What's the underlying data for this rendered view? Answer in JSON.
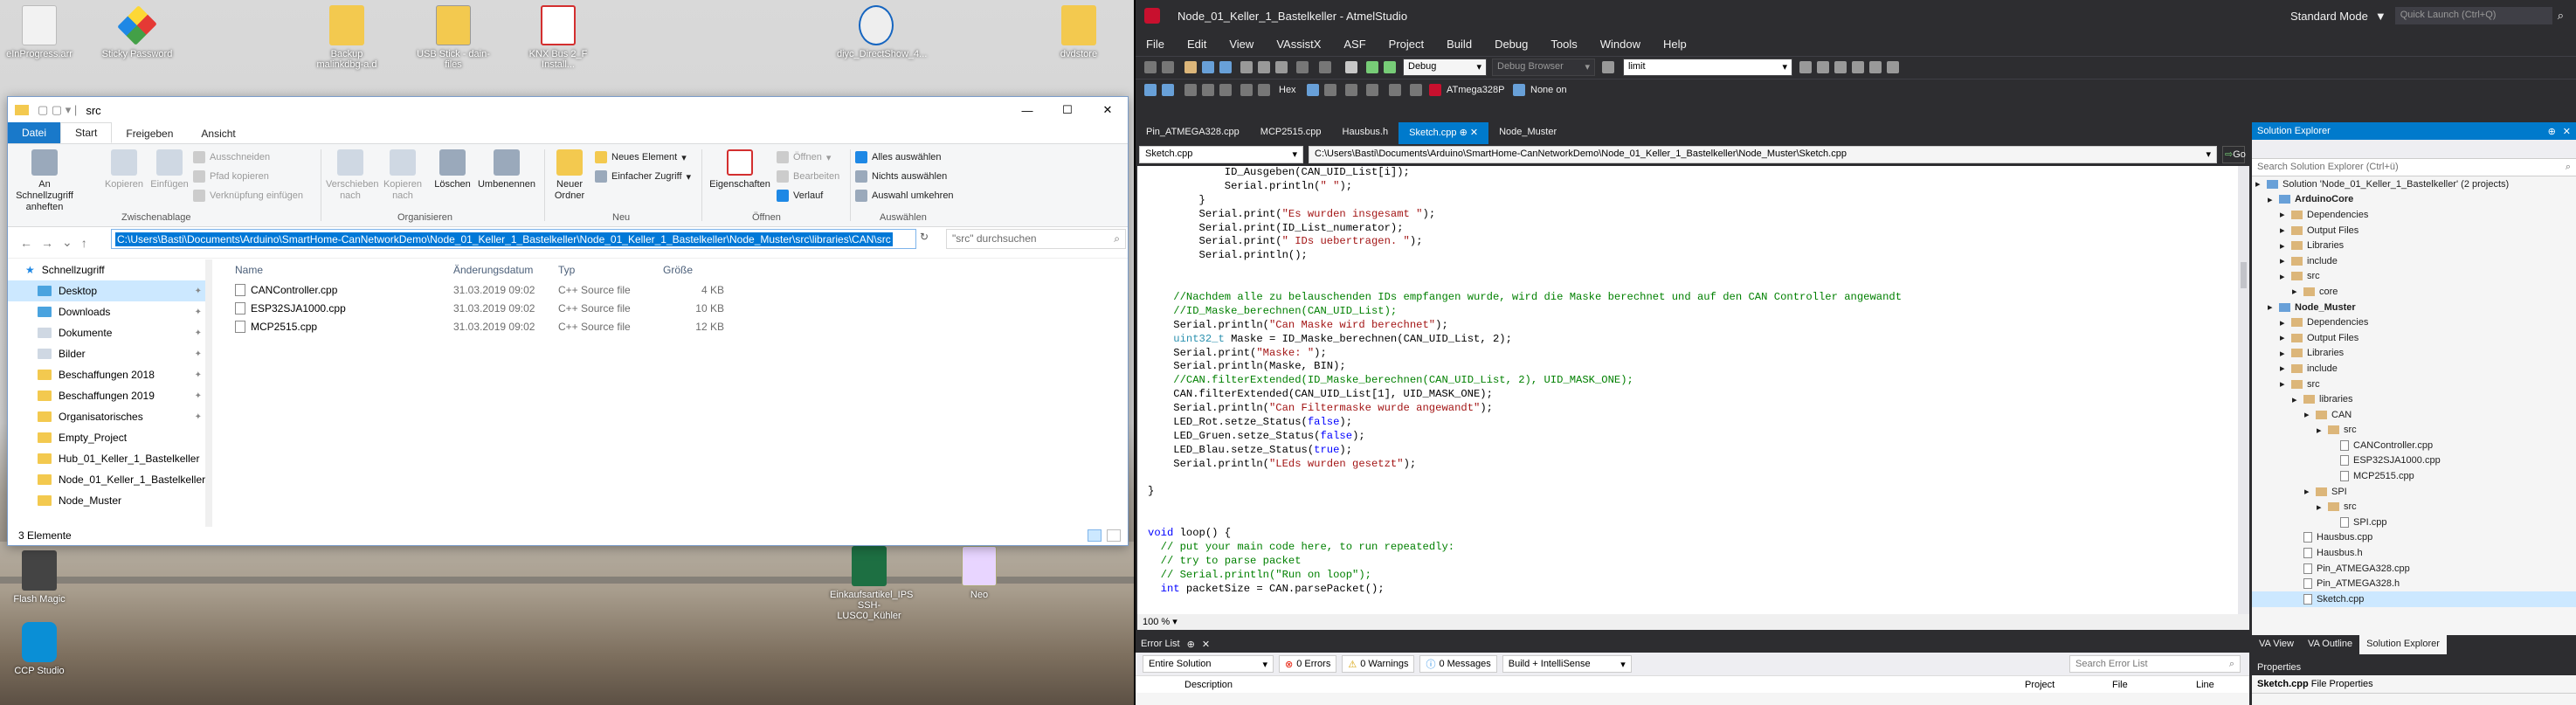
{
  "desktop": {
    "icons": [
      {
        "label": "eInProgress.arr"
      },
      {
        "label": "Sticky Password"
      },
      {
        "label": "Backup malinkdbg-a.d"
      },
      {
        "label": "USB Stick - dain-files"
      },
      {
        "label": "KNX Bus 2_F Install..."
      },
      {
        "label": "diyc_DirectShow_4..."
      },
      {
        "label": "dvdstore"
      },
      {
        "label": "Flash Magic"
      },
      {
        "label": "Einkaufsartikel_IPS SSH-LUSC0_Kühler"
      },
      {
        "label": "Neo"
      },
      {
        "label": "CCP Studio"
      }
    ]
  },
  "explorer": {
    "title": "src",
    "tabs": [
      "Datei",
      "Start",
      "Freigeben",
      "Ansicht"
    ],
    "ribbon": {
      "pin": "An Schnellzugriff anheften",
      "copy": "Kopieren",
      "paste": "Einfügen",
      "cut": "Ausschneiden",
      "copypath": "Pfad kopieren",
      "pasteshortcut": "Verknüpfung einfügen",
      "group_clipboard": "Zwischenablage",
      "move": "Verschieben nach",
      "copyto": "Kopieren nach",
      "delete": "Löschen",
      "rename": "Umbenennen",
      "group_organize": "Organisieren",
      "newfolder": "Neuer Ordner",
      "newitem": "Neues Element",
      "easyaccess": "Einfacher Zugriff",
      "group_new": "Neu",
      "properties": "Eigenschaften",
      "open": "Öffnen",
      "edit": "Bearbeiten",
      "history": "Verlauf",
      "group_open": "Öffnen",
      "selectall": "Alles auswählen",
      "selectnone": "Nichts auswählen",
      "invert": "Auswahl umkehren",
      "group_select": "Auswählen"
    },
    "address": "C:\\Users\\Basti\\Documents\\Arduino\\SmartHome-CanNetworkDemo\\Node_01_Keller_1_Bastelkeller\\Node_01_Keller_1_Bastelkeller\\Node_Muster\\src\\libraries\\CAN\\src",
    "search_placeholder": "\"src\" durchsuchen",
    "nav": [
      "Schnellzugriff",
      "Desktop",
      "Downloads",
      "Dokumente",
      "Bilder",
      "Beschaffungen 2018",
      "Beschaffungen 2019",
      "Organisatorisches",
      "Empty_Project",
      "Hub_01_Keller_1_Bastelkeller",
      "Node_01_Keller_1_Bastelkeller",
      "Node_Muster"
    ],
    "columns": [
      "Name",
      "Änderungsdatum",
      "Typ",
      "Größe"
    ],
    "files": [
      {
        "name": "CANController.cpp",
        "date": "31.03.2019 09:02",
        "type": "C++ Source file",
        "size": "4 KB"
      },
      {
        "name": "ESP32SJA1000.cpp",
        "date": "31.03.2019 09:02",
        "type": "C++ Source file",
        "size": "10 KB"
      },
      {
        "name": "MCP2515.cpp",
        "date": "31.03.2019 09:02",
        "type": "C++ Source file",
        "size": "12 KB"
      }
    ],
    "status": "3 Elemente"
  },
  "atmel": {
    "title": "Node_01_Keller_1_Bastelkeller - AtmelStudio",
    "mode": "Standard Mode",
    "quicklaunch": "Quick Launch (Ctrl+Q)",
    "menu": [
      "File",
      "Edit",
      "View",
      "VAssistX",
      "ASF",
      "Project",
      "Build",
      "Debug",
      "Tools",
      "Window",
      "Help"
    ],
    "config": "Debug",
    "debugbrowser": "Debug Browser",
    "find": "limit",
    "device": "ATmega328P",
    "tool": "None on",
    "hex": "Hex",
    "doctabs": [
      "Pin_ATMEGA328.cpp",
      "MCP2515.cpp",
      "Hausbus.h",
      "Sketch.cpp",
      "Node_Muster"
    ],
    "navfile": "Sketch.cpp",
    "navpath": "C:\\Users\\Basti\\Documents\\Arduino\\SmartHome-CanNetworkDemo\\Node_01_Keller_1_Bastelkeller\\Node_Muster\\Sketch.cpp",
    "go": "Go",
    "code": [
      "            ID_Ausgeben(CAN_UID_List[i]);",
      "            Serial.println(\" \");",
      "        }",
      "        Serial.print(\"Es wurden insgesamt \");",
      "        Serial.print(ID_List_numerator);",
      "        Serial.print(\" IDs uebertragen. \");",
      "        Serial.println();",
      "",
      "",
      "    //Nachdem alle zu belauschenden IDs empfangen wurde, wird die Maske berechnet und auf den CAN Controller angewandt",
      "    //ID_Maske_berechnen(CAN_UID_List);",
      "    Serial.println(\"Can Maske wird berechnet\");",
      "    uint32_t Maske = ID_Maske_berechnen(CAN_UID_List, 2);",
      "    Serial.print(\"Maske: \");",
      "    Serial.println(Maske, BIN);",
      "    //CAN.filterExtended(ID_Maske_berechnen(CAN_UID_List, 2), UID_MASK_ONE);",
      "    CAN.filterExtended(CAN_UID_List[1], UID_MASK_ONE);",
      "    Serial.println(\"Can Filtermaske wurde angewandt\");",
      "    LED_Rot.setze_Status(false);",
      "    LED_Gruen.setze_Status(false);",
      "    LED_Blau.setze_Status(true);",
      "    Serial.println(\"LEds wurden gesetzt\");",
      "",
      "}",
      "",
      "",
      "void loop() {",
      "  // put your main code here, to run repeatedly:",
      "  // try to parse packet",
      "  // Serial.println(\"Run on loop\");",
      "  int packetSize = CAN.parsePacket();"
    ],
    "zoom": "100 %",
    "errorlist": {
      "title": "Error List",
      "scope": "Entire Solution",
      "errors": "0 Errors",
      "warnings": "0 Warnings",
      "messages": "0 Messages",
      "build": "Build + IntelliSense",
      "search": "Search Error List",
      "columns": [
        "Description",
        "Project",
        "File",
        "Line"
      ]
    },
    "solution": {
      "title": "Solution Explorer",
      "search": "Search Solution Explorer (Ctrl+ü)",
      "tree": [
        {
          "label": "Solution 'Node_01_Keller_1_Bastelkeller' (2 projects)",
          "depth": 0,
          "kind": "sol"
        },
        {
          "label": "ArduinoCore",
          "depth": 1,
          "kind": "proj"
        },
        {
          "label": "Dependencies",
          "depth": 2,
          "kind": "folder"
        },
        {
          "label": "Output Files",
          "depth": 2,
          "kind": "folder"
        },
        {
          "label": "Libraries",
          "depth": 2,
          "kind": "folder"
        },
        {
          "label": "include",
          "depth": 2,
          "kind": "folder"
        },
        {
          "label": "src",
          "depth": 2,
          "kind": "folder"
        },
        {
          "label": "core",
          "depth": 3,
          "kind": "folder"
        },
        {
          "label": "Node_Muster",
          "depth": 1,
          "kind": "proj"
        },
        {
          "label": "Dependencies",
          "depth": 2,
          "kind": "folder"
        },
        {
          "label": "Output Files",
          "depth": 2,
          "kind": "folder"
        },
        {
          "label": "Libraries",
          "depth": 2,
          "kind": "folder"
        },
        {
          "label": "include",
          "depth": 2,
          "kind": "folder"
        },
        {
          "label": "src",
          "depth": 2,
          "kind": "folder"
        },
        {
          "label": "libraries",
          "depth": 3,
          "kind": "folder"
        },
        {
          "label": "CAN",
          "depth": 4,
          "kind": "folder"
        },
        {
          "label": "src",
          "depth": 5,
          "kind": "folder"
        },
        {
          "label": "CANController.cpp",
          "depth": 6,
          "kind": "file"
        },
        {
          "label": "ESP32SJA1000.cpp",
          "depth": 6,
          "kind": "file"
        },
        {
          "label": "MCP2515.cpp",
          "depth": 6,
          "kind": "file"
        },
        {
          "label": "SPI",
          "depth": 4,
          "kind": "folder"
        },
        {
          "label": "src",
          "depth": 5,
          "kind": "folder"
        },
        {
          "label": "SPI.cpp",
          "depth": 6,
          "kind": "file"
        },
        {
          "label": "Hausbus.cpp",
          "depth": 3,
          "kind": "file"
        },
        {
          "label": "Hausbus.h",
          "depth": 3,
          "kind": "file"
        },
        {
          "label": "Pin_ATMEGA328.cpp",
          "depth": 3,
          "kind": "file"
        },
        {
          "label": "Pin_ATMEGA328.h",
          "depth": 3,
          "kind": "file"
        },
        {
          "label": "Sketch.cpp",
          "depth": 3,
          "kind": "file",
          "selected": true
        }
      ],
      "bottomtabs": [
        "VA View",
        "VA Outline",
        "Solution Explorer"
      ],
      "properties": "Properties",
      "propfile": "Sketch.cpp",
      "propkind": "File Properties"
    }
  }
}
